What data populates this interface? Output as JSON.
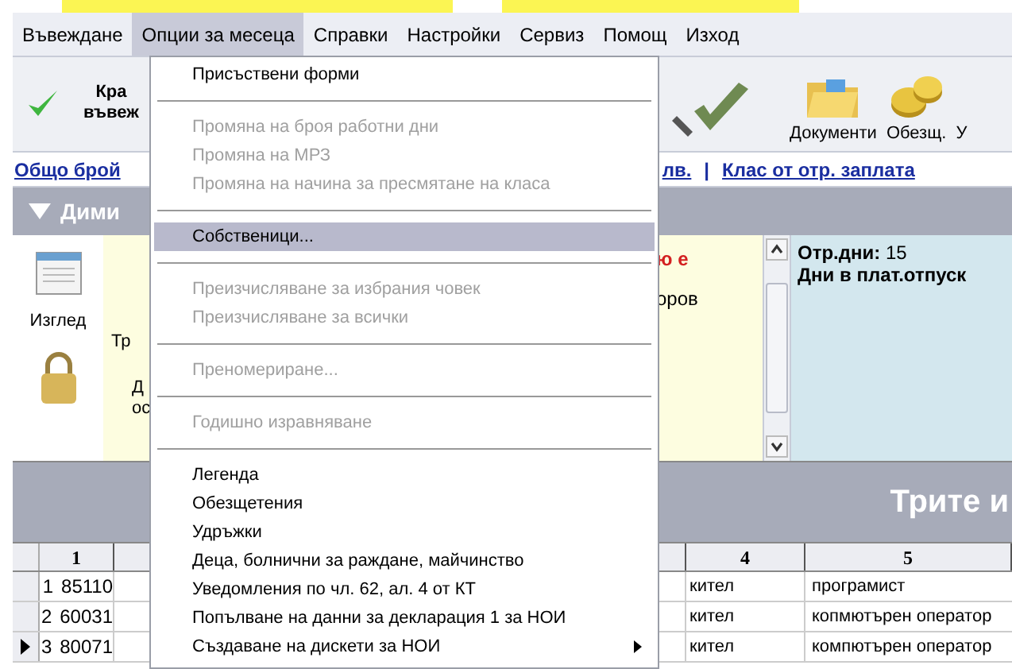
{
  "menu_bar": [
    {
      "label": "Въвеждане",
      "selected": false
    },
    {
      "label": "Опции за месеца",
      "selected": true
    },
    {
      "label": "Справки",
      "selected": false
    },
    {
      "label": "Настройки",
      "selected": false
    },
    {
      "label": "Сервиз",
      "selected": false
    },
    {
      "label": "Помощ",
      "selected": false
    },
    {
      "label": "Изход",
      "selected": false
    }
  ],
  "toolbar": {
    "left_button": {
      "line_1": "Кра",
      "line_2": "въвеж"
    },
    "right_buttons": [
      {
        "label": "Документи"
      },
      {
        "label": "Обезщ."
      },
      {
        "label": "У"
      }
    ]
  },
  "links": [
    {
      "text": "Общо брой"
    },
    {
      "text": "лв."
    },
    {
      "text": "Клас от отр. заплата"
    }
  ],
  "link_separator": "|",
  "panel": {
    "title": "Дими",
    "side_tools": [
      {
        "label": "Изглед"
      }
    ],
    "texts": [
      "Тр",
      "Д",
      "ос"
    ],
    "warning": "ю е",
    "surname": "оров",
    "stats": {
      "label": "Отр.дни:",
      "value": "15",
      "line_2": "Дни в плат.отпуск"
    }
  },
  "band_title": "Трите и",
  "table": {
    "columns": [
      "1",
      "4",
      "5"
    ],
    "rows": [
      {
        "number": "1",
        "column_2": "85110",
        "column_4": "кител",
        "column_5": "програмист",
        "selected": false
      },
      {
        "number": "2",
        "column_2": "60031",
        "column_4": "кител",
        "column_5": "копмютърен оператор",
        "selected": false
      },
      {
        "number": "3",
        "column_2": "80071",
        "column_4": "кител",
        "column_5": "компютърен оператор",
        "selected": true
      }
    ]
  },
  "dropdown": [
    {
      "kind": "item",
      "label": "Присъствени форми",
      "disabled": false,
      "selected": false
    },
    {
      "kind": "separator"
    },
    {
      "kind": "item",
      "label": "Промяна на броя работни дни",
      "disabled": true,
      "selected": false
    },
    {
      "kind": "item",
      "label": "Промяна на МРЗ",
      "disabled": true,
      "selected": false
    },
    {
      "kind": "item",
      "label": "Промяна на начина за пресмятане на класа",
      "disabled": true,
      "selected": false
    },
    {
      "kind": "separator"
    },
    {
      "kind": "item",
      "label": "Собственици...",
      "disabled": false,
      "selected": true
    },
    {
      "kind": "separator"
    },
    {
      "kind": "item",
      "label": "Преизчисляване за избрания човек",
      "disabled": true,
      "selected": false
    },
    {
      "kind": "item",
      "label": "Преизчисляване за всички",
      "disabled": true,
      "selected": false
    },
    {
      "kind": "separator"
    },
    {
      "kind": "item",
      "label": "Преномериране...",
      "disabled": true,
      "selected": false
    },
    {
      "kind": "separator"
    },
    {
      "kind": "item",
      "label": "Годишно изравняване",
      "disabled": true,
      "selected": false
    },
    {
      "kind": "separator"
    },
    {
      "kind": "item",
      "label": "Легенда",
      "disabled": false,
      "selected": false
    },
    {
      "kind": "item",
      "label": "Обезщетения",
      "disabled": false,
      "selected": false
    },
    {
      "kind": "item",
      "label": "Удръжки",
      "disabled": false,
      "selected": false
    },
    {
      "kind": "item",
      "label": "Деца, болнични за раждане, майчинство",
      "disabled": false,
      "selected": false
    },
    {
      "kind": "item",
      "label": "Уведомления по чл. 62, ал. 4 от КТ",
      "disabled": false,
      "selected": false
    },
    {
      "kind": "item",
      "label": "Попълване на данни за декларация 1 за НОИ",
      "disabled": false,
      "selected": false
    },
    {
      "kind": "submenu",
      "label": "Създаване на дискети за НОИ",
      "disabled": false,
      "selected": false
    }
  ]
}
